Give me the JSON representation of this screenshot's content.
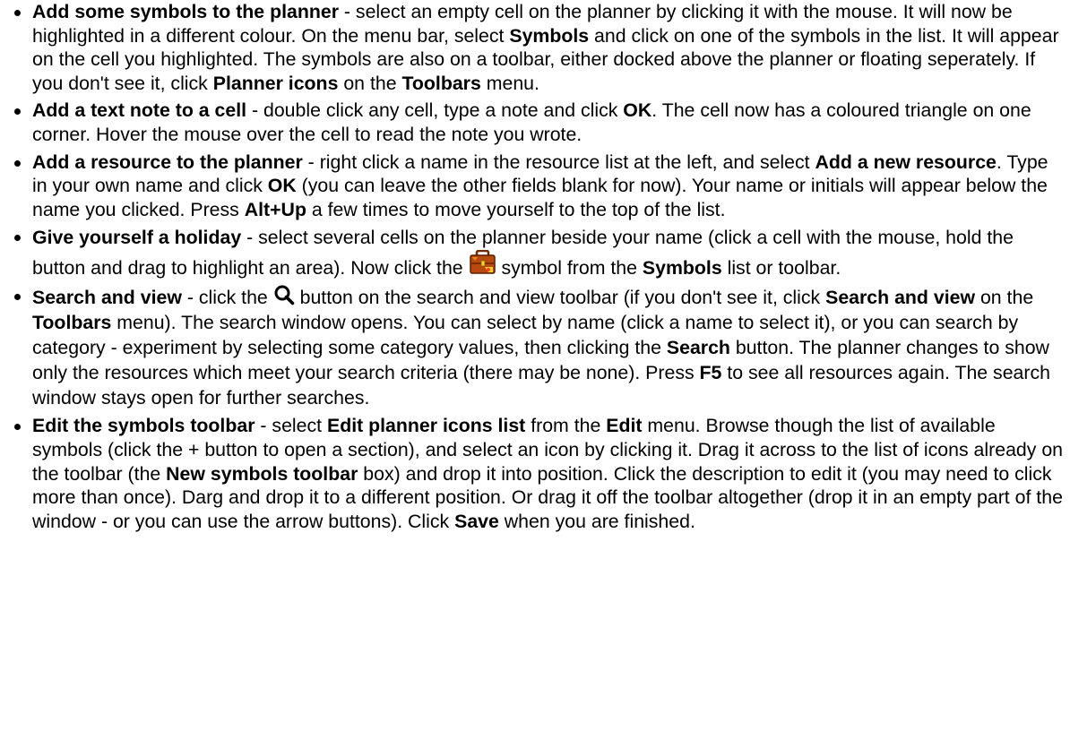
{
  "items": [
    {
      "title": "Add some symbols to the planner",
      "p1": " - select an empty cell on the planner by clicking it with the mouse. It will now be highlighted in a different colour. On the menu bar, select ",
      "b1": "Symbols",
      "p2": " and click on one of the symbols in the list. It will appear on the cell you highlighted. The symbols are also on a toolbar, either docked above the planner or floating seperately. If you don't see it, click ",
      "b2": "Planner icons",
      "p3": " on the ",
      "b3": "Toolbars",
      "p4": " menu."
    },
    {
      "title": "Add a text note to a cell",
      "p1": " - double click any cell, type a note and click ",
      "b1": "OK",
      "p2": ". The cell now has a coloured triangle on one corner. Hover the mouse over the cell to read the note you wrote."
    },
    {
      "title": "Add a resource to the planner",
      "p1": " - right click a name in the resource list at the left, and select ",
      "b1": "Add a new resource",
      "p2": ". Type in your own name and click ",
      "b2": "OK",
      "p3": " (you can leave the other fields blank for now). Your name or initials will appear below the name you clicked. Press ",
      "b3": "Alt+Up",
      "p4": " a few times to move yourself to the top of the list."
    },
    {
      "title": "Give yourself a holiday",
      "p1": " - select several cells on the planner beside your name (click a cell with the mouse, hold the button and drag to highlight an area). Now click the ",
      "icon": "holiday-suitcase-icon",
      "p2": " symbol from the ",
      "b1": "Symbols",
      "p3": " list or toolbar."
    },
    {
      "title": "Search and view",
      "p1": " - click the ",
      "icon": "search-icon",
      "p2": " button on the search and view toolbar (if you don't see it, click ",
      "b1": "Search and view",
      "p3": " on the ",
      "b2": "Toolbars",
      "p4": " menu). The search window opens. You can select by name (click a name to select it), or you can search by category - experiment by selecting some category values, then clicking the ",
      "b3": "Search",
      "p5": " button. The planner changes to show only the resources which meet your search criteria (there may be none). Press ",
      "b4": "F5",
      "p6": " to see all resources again. The search window stays open for further searches."
    },
    {
      "title": "Edit the symbols toolbar",
      "p1": " - select ",
      "b1": "Edit planner icons list",
      "p2": " from the ",
      "b2": "Edit",
      "p3": " menu. Browse though the list of available symbols (click the + button to open a section), and select an icon by clicking it. Drag it across to the list of icons already on the toolbar (the ",
      "b3": "New symbols toolbar",
      "p4": " box) and drop it into position. Click the description to edit it (you may need to click more than once). Darg and drop it to a different position. Or drag it off the toolbar altogether (drop it in an empty part of the window - or you can use the arrow buttons). Click ",
      "b4": "Save",
      "p5": " when you are finished."
    }
  ]
}
